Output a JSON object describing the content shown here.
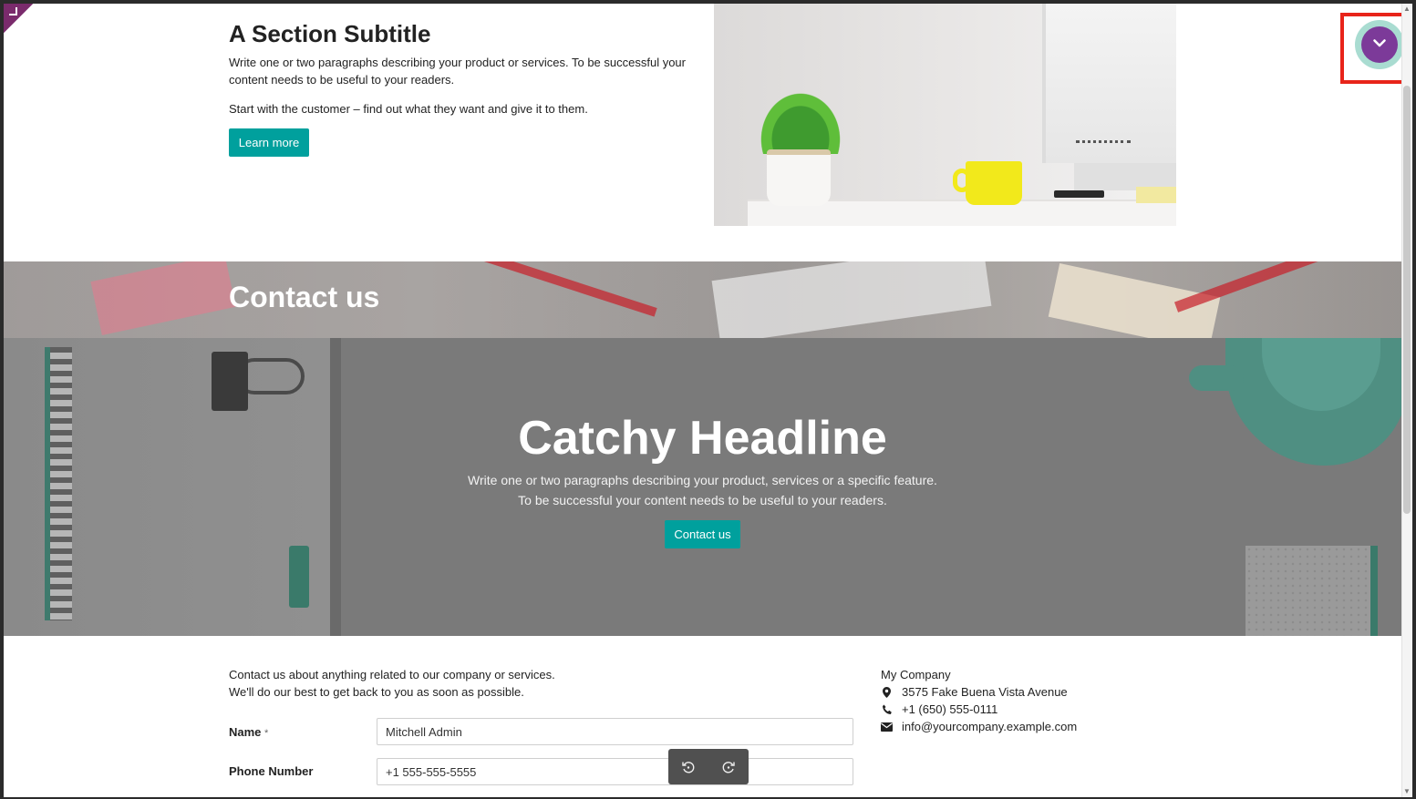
{
  "section": {
    "subtitle": "A Section Subtitle",
    "paragraph1": "Write one or two paragraphs describing your product or services. To be successful your content needs to be useful to your readers.",
    "paragraph2": "Start with the customer – find out what they want and give it to them.",
    "button": "Learn more"
  },
  "contact_band": {
    "title": "Contact us"
  },
  "catchy": {
    "headline": "Catchy Headline",
    "line1": "Write one or two paragraphs describing your product, services or a specific feature.",
    "line2": "To be successful your content needs to be useful to your readers.",
    "button": "Contact us"
  },
  "form": {
    "intro1": "Contact us about anything related to our company or services.",
    "intro2": "We'll do our best to get back to you as soon as possible.",
    "fields": [
      {
        "label": "Name",
        "required": "*",
        "value": "Mitchell Admin"
      },
      {
        "label": "Phone Number",
        "value": "+1 555-555-5555"
      }
    ]
  },
  "company": {
    "name": "My Company",
    "address": "3575 Fake Buena Vista Avenue",
    "phone": "+1 (650) 555-0111",
    "email": "info@yourcompany.example.com"
  },
  "icons": {
    "toggle": "chevron-down-icon",
    "undo": "undo-icon",
    "redo": "redo-icon",
    "address": "map-marker-icon",
    "phone": "phone-icon",
    "email": "envelope-icon"
  },
  "colors": {
    "accent_teal": "#00a09d",
    "toggle_purple": "#7c3a99",
    "highlight_red": "#e8241a"
  }
}
